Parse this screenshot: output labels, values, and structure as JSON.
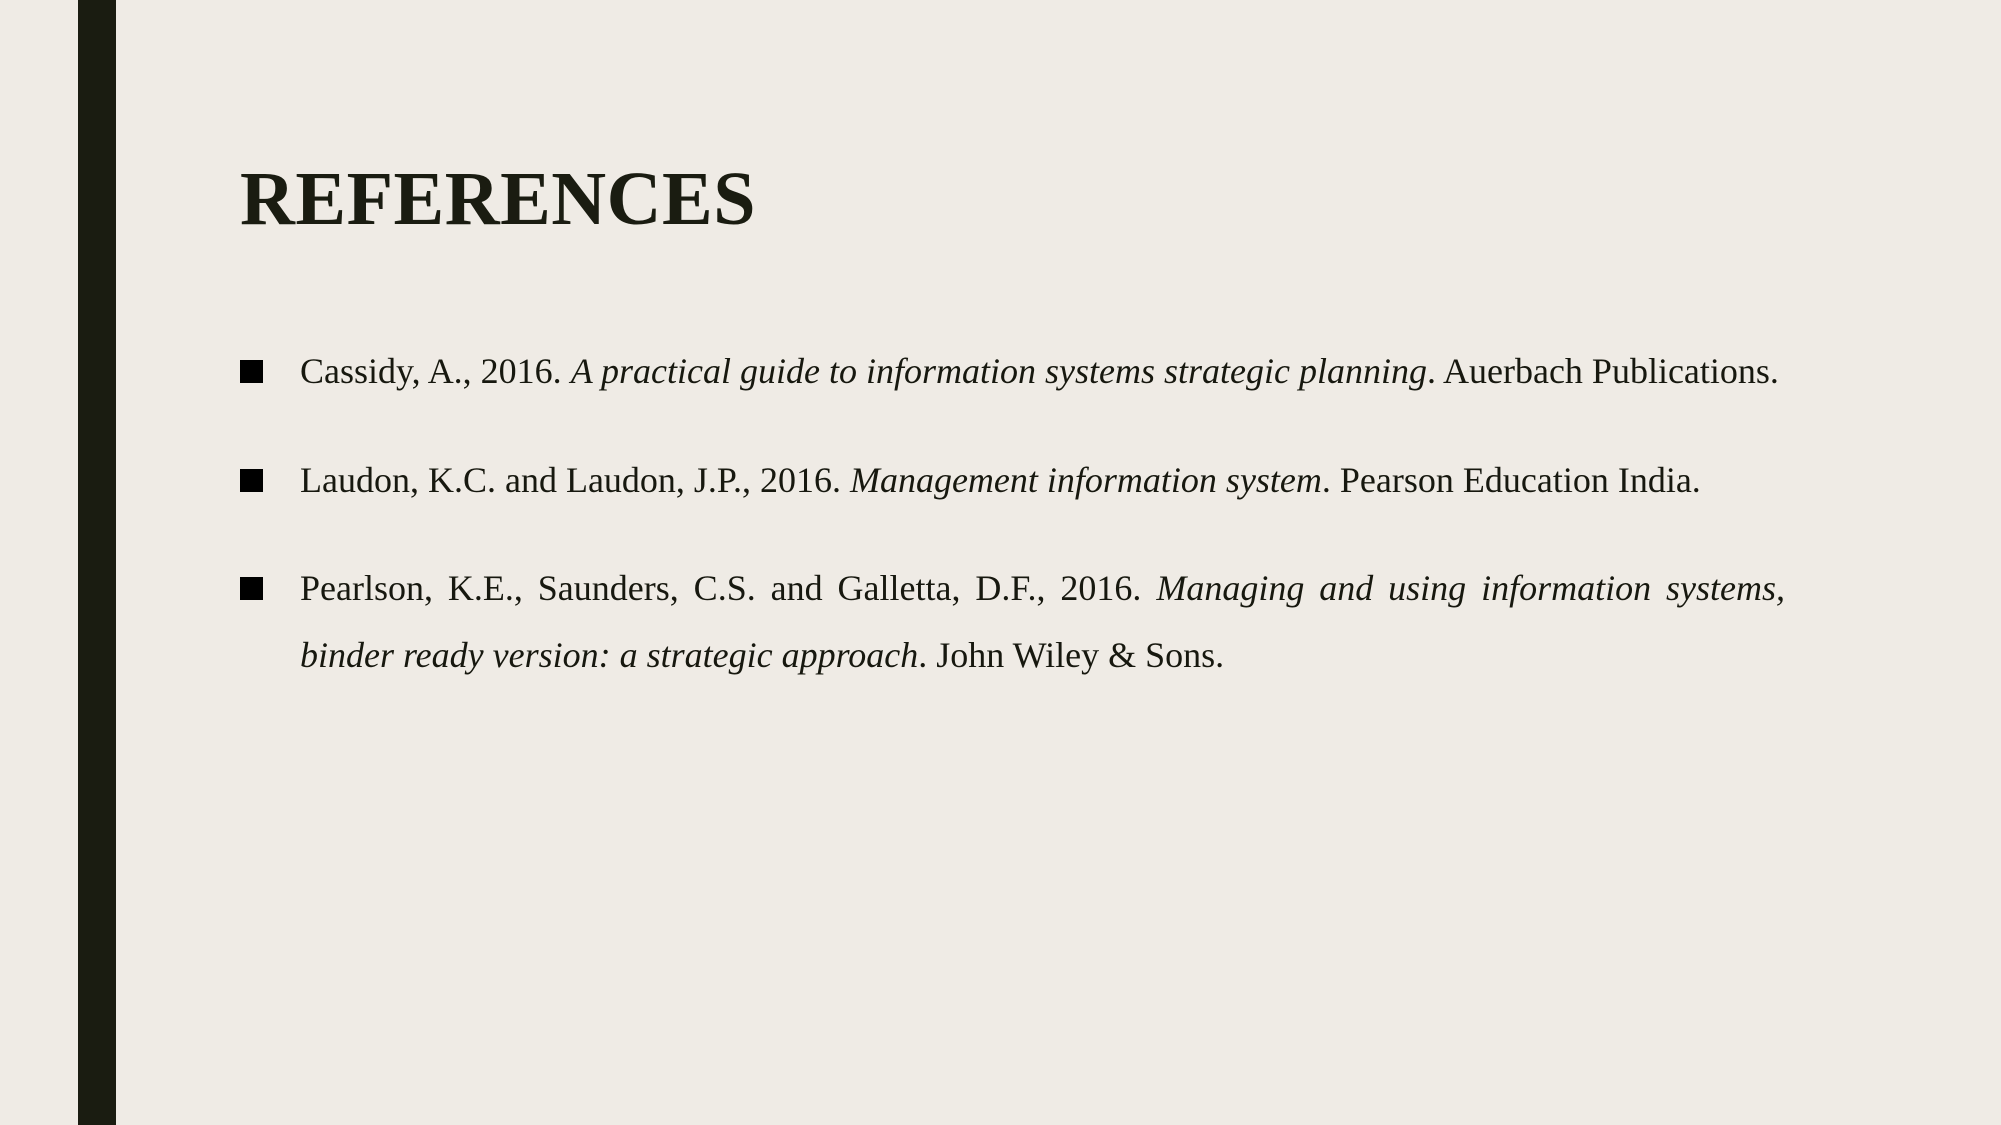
{
  "slide": {
    "title": "REFERENCES",
    "background_color": "#efebe5",
    "text_color": "#17180f",
    "accent_bar_color": "#1a1c11",
    "bullet_glyph": "filled-square"
  },
  "references": [
    {
      "authors_and_year": "Cassidy, A., 2016. ",
      "title_italic": "A practical guide to information systems strategic planning",
      "publisher": ". Auerbach Publications."
    },
    {
      "authors_and_year": "Laudon, K.C. and Laudon, J.P., 2016. ",
      "title_italic": "Management information system",
      "publisher": ". Pearson Education India."
    },
    {
      "authors_and_year": "Pearlson, K.E., Saunders, C.S. and Galletta, D.F., 2016. ",
      "title_italic": "Managing and using information systems, binder ready version: a strategic approach",
      "publisher": ". John Wiley & Sons."
    }
  ]
}
